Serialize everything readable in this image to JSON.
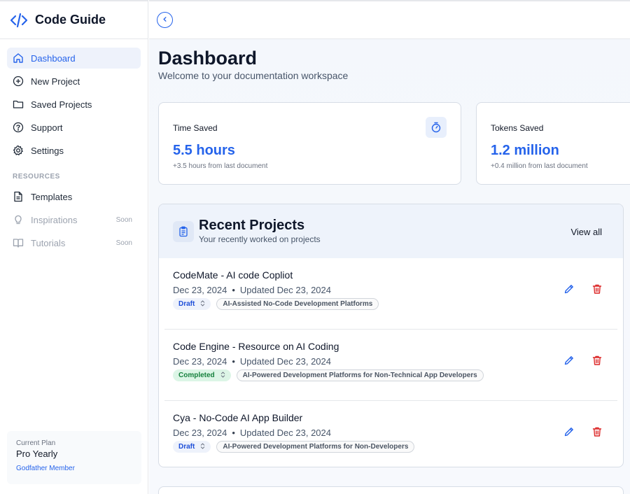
{
  "brand": {
    "title": "Code Guide"
  },
  "nav": {
    "items": [
      {
        "label": "Dashboard",
        "icon": "home-icon"
      },
      {
        "label": "New Project",
        "icon": "plus-circle-icon"
      },
      {
        "label": "Saved Projects",
        "icon": "folder-icon"
      },
      {
        "label": "Support",
        "icon": "help-circle-icon"
      },
      {
        "label": "Settings",
        "icon": "gear-icon"
      }
    ],
    "resources_label": "RESOURCES",
    "resources": [
      {
        "label": "Templates",
        "icon": "file-icon",
        "badge": ""
      },
      {
        "label": "Inspirations",
        "icon": "lightbulb-icon",
        "badge": "Soon"
      },
      {
        "label": "Tutorials",
        "icon": "book-icon",
        "badge": "Soon"
      }
    ]
  },
  "plan": {
    "label": "Current Plan",
    "name": "Pro Yearly",
    "member": "Godfather Member"
  },
  "page": {
    "title": "Dashboard",
    "subtitle": "Welcome to your documentation workspace"
  },
  "stats": [
    {
      "label": "Time Saved",
      "value": "5.5 hours",
      "delta": "+3.5 hours from last document"
    },
    {
      "label": "Tokens Saved",
      "value": "1.2 million",
      "delta": "+0.4 million from last document"
    }
  ],
  "recent": {
    "title": "Recent Projects",
    "subtitle": "Your recently worked on projects",
    "view_all": "View all",
    "projects": [
      {
        "title": "CodeMate - AI code Copliot",
        "created": "Dec 23, 2024",
        "updated": "Updated Dec 23, 2024",
        "status": "Draft",
        "tag": "AI-Assisted No-Code Development Platforms"
      },
      {
        "title": "Code Engine - Resource on AI Coding",
        "created": "Dec 23, 2024",
        "updated": "Updated Dec 23, 2024",
        "status": "Completed",
        "tag": "AI-Powered Development Platforms for Non-Technical App Developers"
      },
      {
        "title": "Cya - No-Code AI App Builder",
        "created": "Dec 23, 2024",
        "updated": "Updated Dec 23, 2024",
        "status": "Draft",
        "tag": "AI-Powered Development Platforms for Non-Developers"
      }
    ]
  },
  "colors": {
    "accent": "#2563eb",
    "danger": "#dc2626",
    "success": "#15803d"
  }
}
